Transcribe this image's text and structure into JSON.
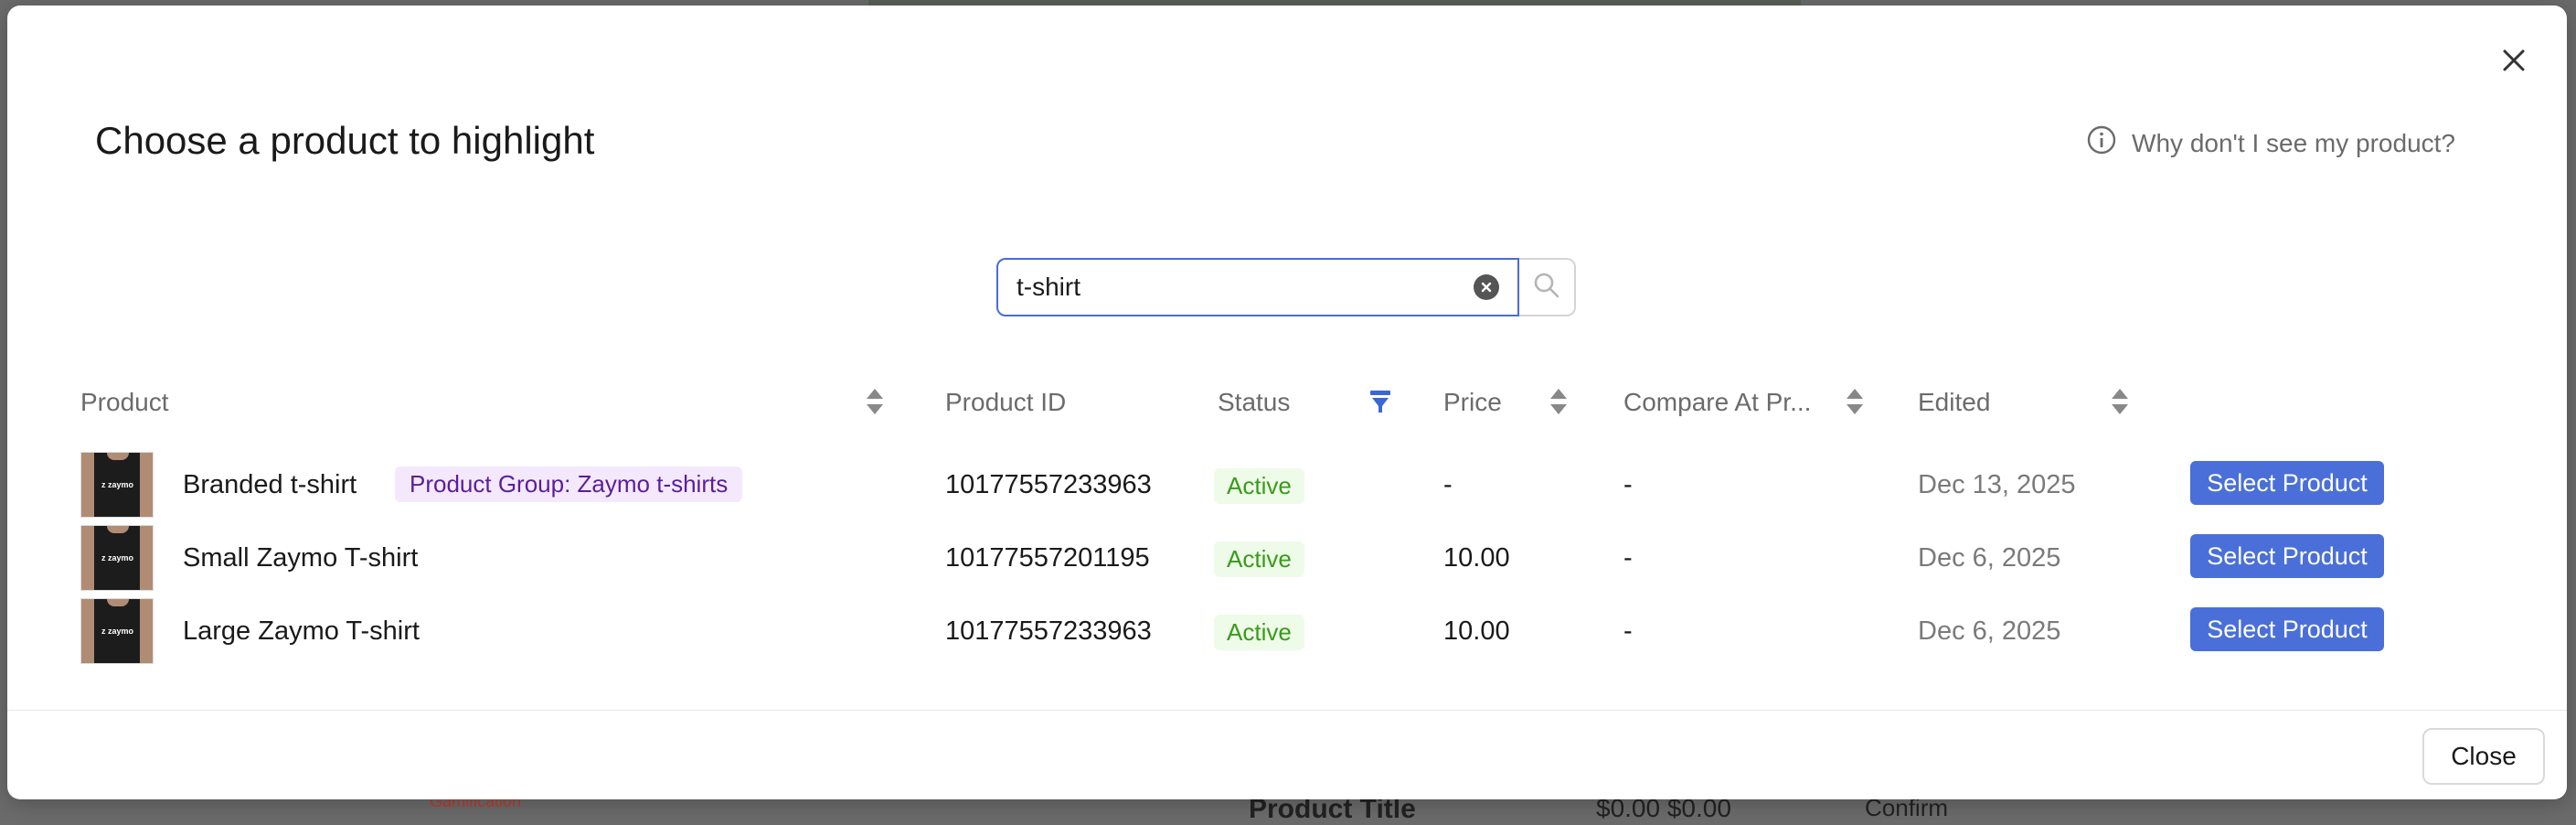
{
  "modal": {
    "title": "Choose a product to highlight",
    "help_link": "Why don't I see my product?",
    "close_label": "Close"
  },
  "search": {
    "value": "t-shirt",
    "placeholder": ""
  },
  "table": {
    "headers": {
      "product": "Product",
      "product_id": "Product ID",
      "status": "Status",
      "price": "Price",
      "compare_at": "Compare At Pr...",
      "edited": "Edited"
    },
    "rows": [
      {
        "name": "Branded t-shirt",
        "group": "Product Group: Zaymo t-shirts",
        "id": "10177557233963",
        "status": "Active",
        "price": "-",
        "compare_at": "-",
        "edited": "Dec 13, 2025",
        "action": "Select Product",
        "thumb_logo": "z zaymo"
      },
      {
        "name": "Small Zaymo T-shirt",
        "group": "",
        "id": "10177557201195",
        "status": "Active",
        "price": "10.00",
        "compare_at": "-",
        "edited": "Dec 6, 2025",
        "action": "Select Product",
        "thumb_logo": "z zaymo"
      },
      {
        "name": "Large Zaymo T-shirt",
        "group": "",
        "id": "10177557233963",
        "status": "Active",
        "price": "10.00",
        "compare_at": "-",
        "edited": "Dec 6, 2025",
        "action": "Select Product",
        "thumb_logo": "z zaymo"
      }
    ]
  },
  "backdrop": {
    "product_title": "Product Title",
    "prices": "$0.00 $0.00",
    "confirm": "Confirm",
    "gamification": "Gamification"
  },
  "colors": {
    "accent": "#4a6fd8",
    "status_green": "#3a9a1c",
    "group_purple": "#5a1e9a"
  },
  "icons": {
    "close": "close-icon",
    "info": "info-icon",
    "search": "search-icon",
    "clear": "clear-icon",
    "sort": "sort-icon",
    "filter": "filter-icon"
  }
}
